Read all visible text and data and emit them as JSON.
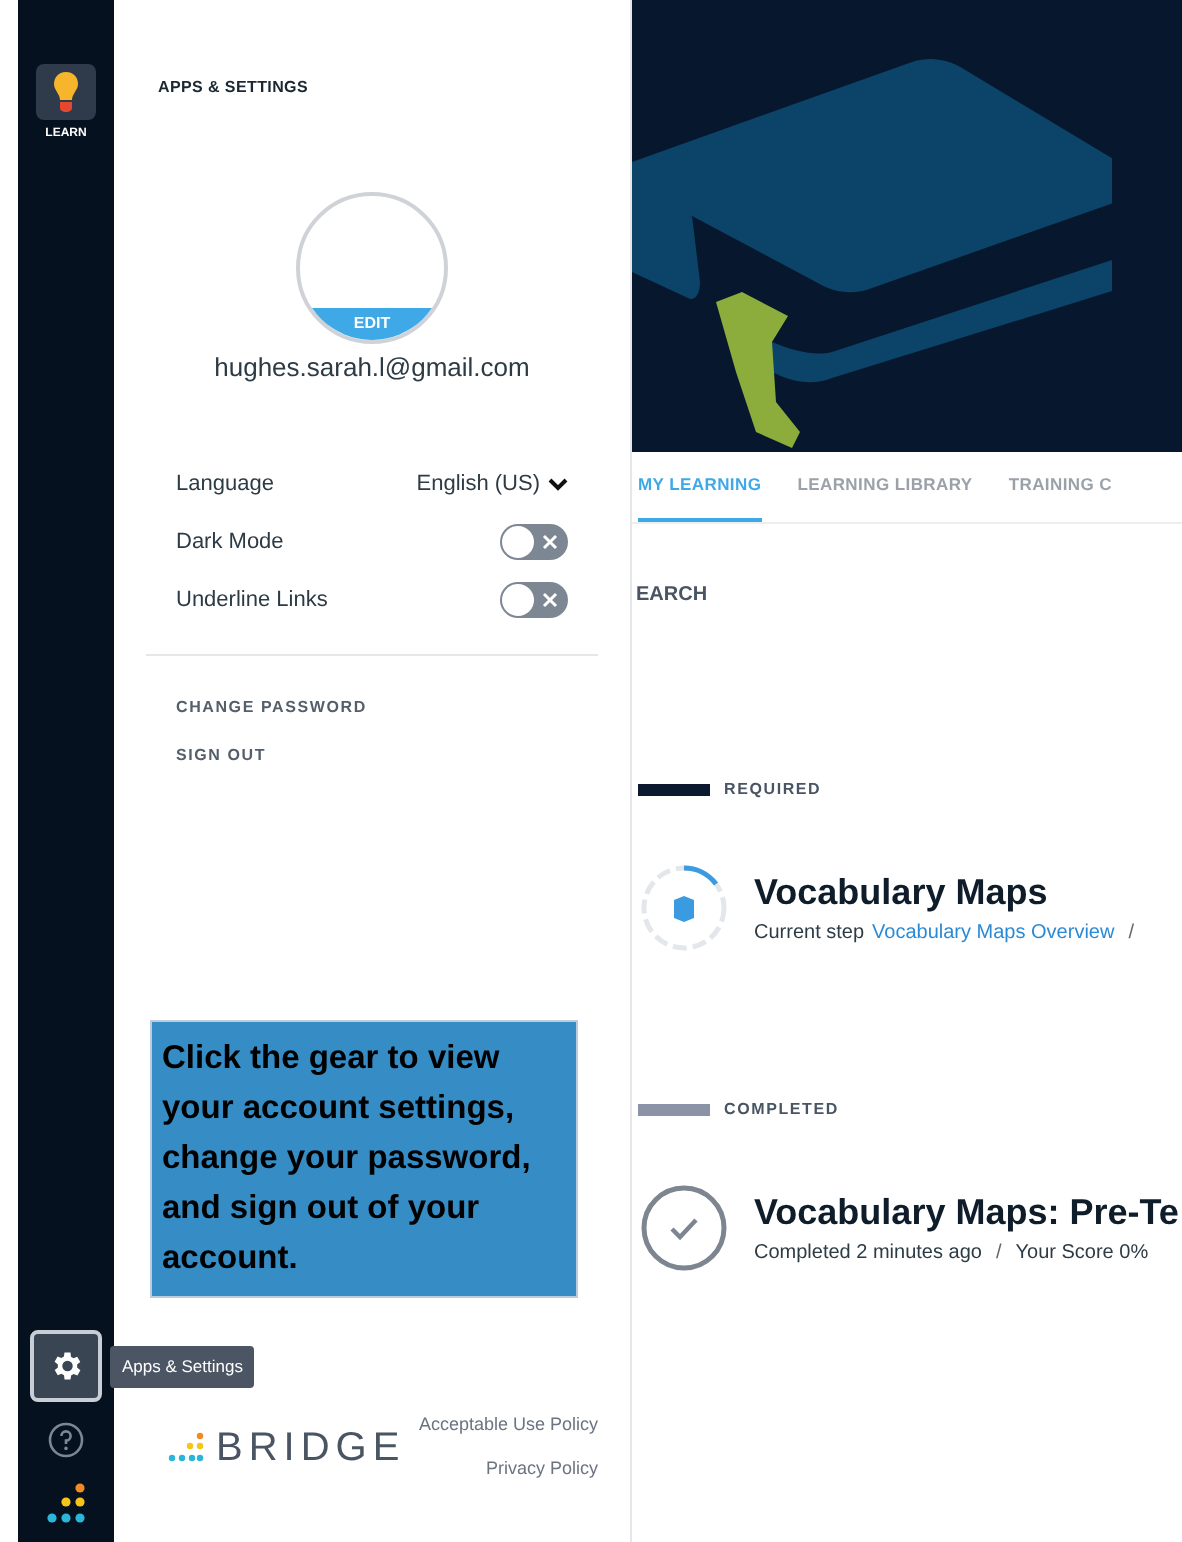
{
  "sidebar": {
    "apps": [
      {
        "label": "LEARN",
        "selected": true
      }
    ],
    "settings_tooltip": "Apps & Settings"
  },
  "settings_panel": {
    "title": "APPS & SETTINGS",
    "avatar_button": "EDIT",
    "email": "hughes.sarah.l@gmail.com",
    "options": [
      {
        "kind": "select",
        "label": "Language",
        "value": "English (US)"
      },
      {
        "kind": "toggle",
        "label": "Dark Mode",
        "on": false
      },
      {
        "kind": "toggle",
        "label": "Underline Links",
        "on": false
      }
    ],
    "links": [
      "CHANGE PASSWORD",
      "SIGN OUT"
    ],
    "callout": "Click the gear to view your account settings, change your password, and sign out of your account.",
    "logo": "BRIDGE",
    "footer_links": [
      "Acceptable Use Policy",
      "Privacy Policy"
    ]
  },
  "content": {
    "tabs": [
      {
        "label": "MY LEARNING",
        "selected": true
      },
      {
        "label": "LEARNING LIBRARY",
        "selected": false
      },
      {
        "label": "TRAINING C",
        "selected": false
      }
    ],
    "search_label": "EARCH",
    "sections": [
      {
        "heading": "REQUIRED",
        "color": "#0b1a2e",
        "items": [
          {
            "kind": "in_progress",
            "title": "Vocabulary Maps",
            "meta": "Current step",
            "link": "Vocabulary Maps Overview",
            "separator": "/"
          }
        ]
      },
      {
        "heading": "COMPLETED",
        "color": "#8a94a6",
        "items": [
          {
            "kind": "completed",
            "title": "Vocabulary Maps: Pre-Te",
            "meta": "Completed 2 minutes ago",
            "separator": "/",
            "score": "Your Score 0%"
          }
        ]
      }
    ]
  }
}
